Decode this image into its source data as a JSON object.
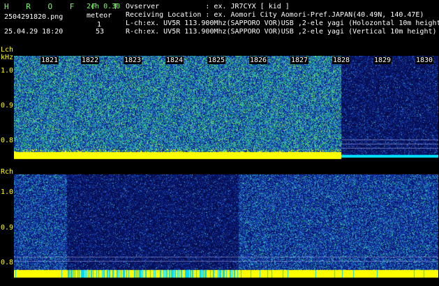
{
  "header": {
    "logo": "H R O F F T",
    "version": "2ch 0.30",
    "meteor_label": "meteor",
    "filename": "2504291820.png",
    "datetime": "25.04.29 18:20",
    "count_l": "1",
    "count_r": "53",
    "observer": "Ovserver           : ex. JR7CYX [ kid ]",
    "location": "Receiving Location : ex. Aomori City Aomori-Pref.JAPAN(40.49N, 140.47E)",
    "lch_info": "L-ch:ex. UV5R 113.900Mhz(SAPPORO VOR)USB ,2-ele yagi (Holozontal 10m height)",
    "rch_info": "R-ch:ex. UV5R 113.900Mhz(SAPPORO VOR)USB ,2-ele yagi (Vertical 10m height)"
  },
  "lch": {
    "label": "Lch",
    "unit": "kHz",
    "y_ticks": [
      "1.0",
      "0.9",
      "0.8"
    ],
    "minutes": [
      "1821",
      "1822",
      "1823",
      "1824",
      "1825",
      "1826",
      "1827",
      "1828",
      "1829",
      "1830"
    ]
  },
  "rch": {
    "label": "Rch",
    "y_ticks": [
      "1.0",
      "0.9",
      "0.8"
    ]
  },
  "colors": {
    "text_green": "#7cfc6a",
    "axis_yellow": "#ffff00",
    "noise_low": "#0a1f80",
    "noise_mid": "#2a6ad0",
    "noise_high": "#38c8a0",
    "tone_band": "#ffff00",
    "tone_band_alt": "#00e0ff"
  }
}
